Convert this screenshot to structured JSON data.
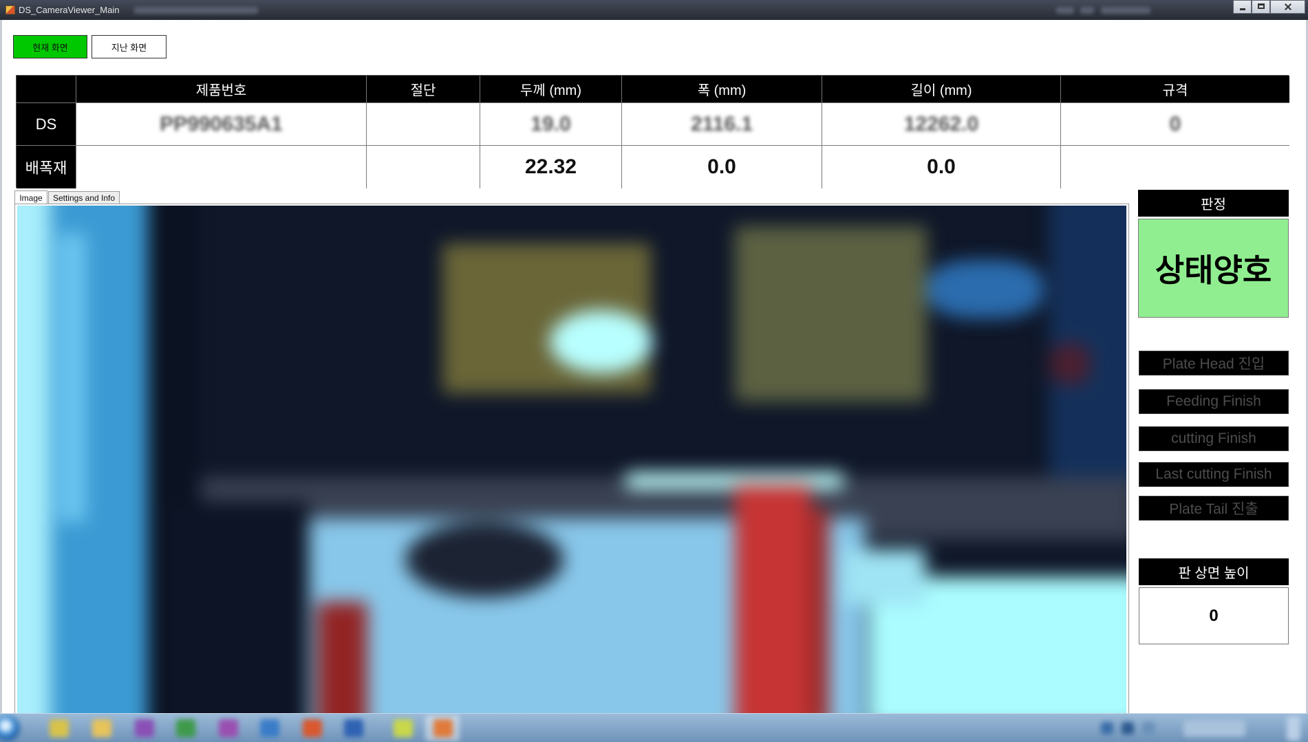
{
  "window": {
    "title": "DS_CameraViewer_Main",
    "icons": {
      "app": "app-window-icon",
      "minimize": "minimize-icon",
      "maximize": "maximize-icon",
      "close": "close-icon"
    }
  },
  "view_buttons": {
    "current": "현재 화면",
    "previous": "지난 화면"
  },
  "table": {
    "headers": [
      "제품번호",
      "절단",
      "두께 (mm)",
      "폭 (mm)",
      "길이 (mm)",
      "규격"
    ],
    "rows": [
      {
        "label": "DS",
        "cells": [
          "PP990635A1",
          "",
          "19.0",
          "2116.1",
          "12262.0",
          "0"
        ]
      },
      {
        "label": "배폭재",
        "cells": [
          "",
          "",
          "22.32",
          "0.0",
          "0.0",
          ""
        ]
      }
    ]
  },
  "tabs": {
    "image": "Image",
    "settings": "Settings and Info"
  },
  "judgment": {
    "title": "판정",
    "status": "상태양호"
  },
  "signals": [
    "Plate Head 진입",
    "Feeding Finish",
    "cutting Finish",
    "Last cutting Finish",
    "Plate Tail 진출"
  ],
  "plate_height": {
    "title": "판 상면 높이",
    "value": "0"
  },
  "colors": {
    "current_button": "#00c800",
    "status_ok": "#90ee90",
    "header_bg": "#000000",
    "signal_inactive_text": "#4d4d4d"
  }
}
